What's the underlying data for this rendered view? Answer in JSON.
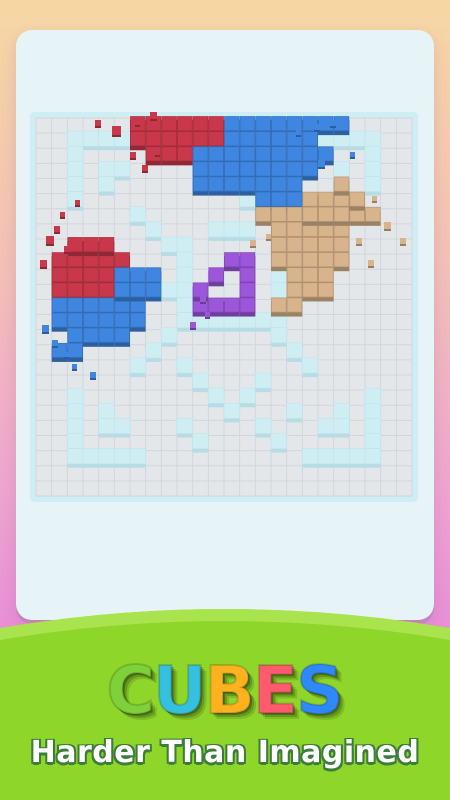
{
  "app": {
    "logo_letters": [
      "C",
      "U",
      "B",
      "E",
      "S"
    ],
    "logo_colors": [
      "#7fd13b",
      "#35c0e0",
      "#ffb21e",
      "#ff5a6e",
      "#2f88ff"
    ],
    "tagline": "Harder Than Imagined"
  },
  "theme": {
    "card_bg": "#e6f4f7",
    "board_floor": "#e4e7ea",
    "wall": "#cfeef4",
    "red_block": "#c8374a",
    "blue_block": "#3f86e0",
    "tan_block": "#d8b48c",
    "purple_block": "#9b56d9",
    "banner_green": "#8fd62a"
  },
  "board": {
    "grid_columns": 24,
    "grid_rows": 25,
    "pieces": [
      {
        "name": "red",
        "color_key": "red_block"
      },
      {
        "name": "blue",
        "color_key": "blue_block"
      },
      {
        "name": "tan",
        "color_key": "tan_block"
      },
      {
        "name": "purple",
        "color_key": "purple_block"
      }
    ]
  }
}
